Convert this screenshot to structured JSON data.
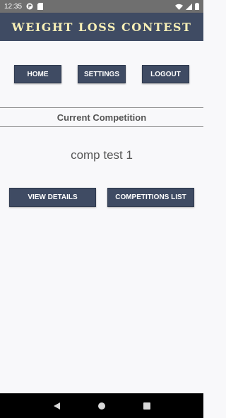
{
  "status_bar": {
    "time": "12:35",
    "icons": [
      "notification-icon",
      "sd-card-icon",
      "wifi-icon",
      "signal-icon",
      "battery-icon"
    ]
  },
  "header": {
    "title": "WEIGHT LOSS CONTEST"
  },
  "nav": {
    "home": "HOME",
    "settings": "SETTINGS",
    "logout": "LOGOUT"
  },
  "current": {
    "section_title": "Current Competition",
    "competition_name": "comp test 1",
    "view_details": "VIEW DETAILS",
    "competitions_list": "COMPETITIONS LIST"
  },
  "system_nav": {
    "icons": [
      "back-icon",
      "home-circle-icon",
      "recents-icon"
    ]
  },
  "colors": {
    "header_bg": "#3f4b63",
    "title_color": "#f7efb6",
    "button_bg": "#3f4b63",
    "page_bg": "#f8f8fa",
    "status_bar_bg": "#6f6f6f"
  }
}
